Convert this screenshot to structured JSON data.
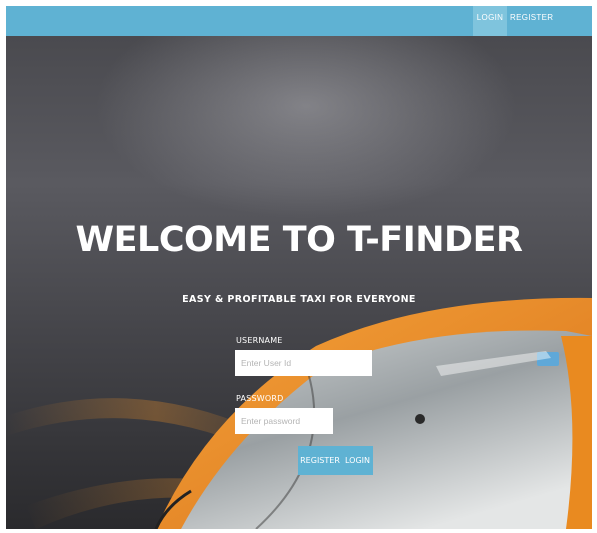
{
  "navbar": {
    "login_label": "LOGIN",
    "register_label": "REGISTER"
  },
  "hero": {
    "title": "WELCOME TO T-FINDER",
    "subtitle": "EASY & PROFITABLE TAXI FOR EVERYONE"
  },
  "form": {
    "username_label": "USERNAME",
    "username_placeholder": "Enter User Id",
    "password_label": "PASSWORD",
    "password_placeholder": "Enter password",
    "register_button": "REGISTER",
    "login_button": "LOGIN"
  },
  "colors": {
    "accent": "#5fb2d3",
    "taxi_orange": "#f08a1c"
  }
}
